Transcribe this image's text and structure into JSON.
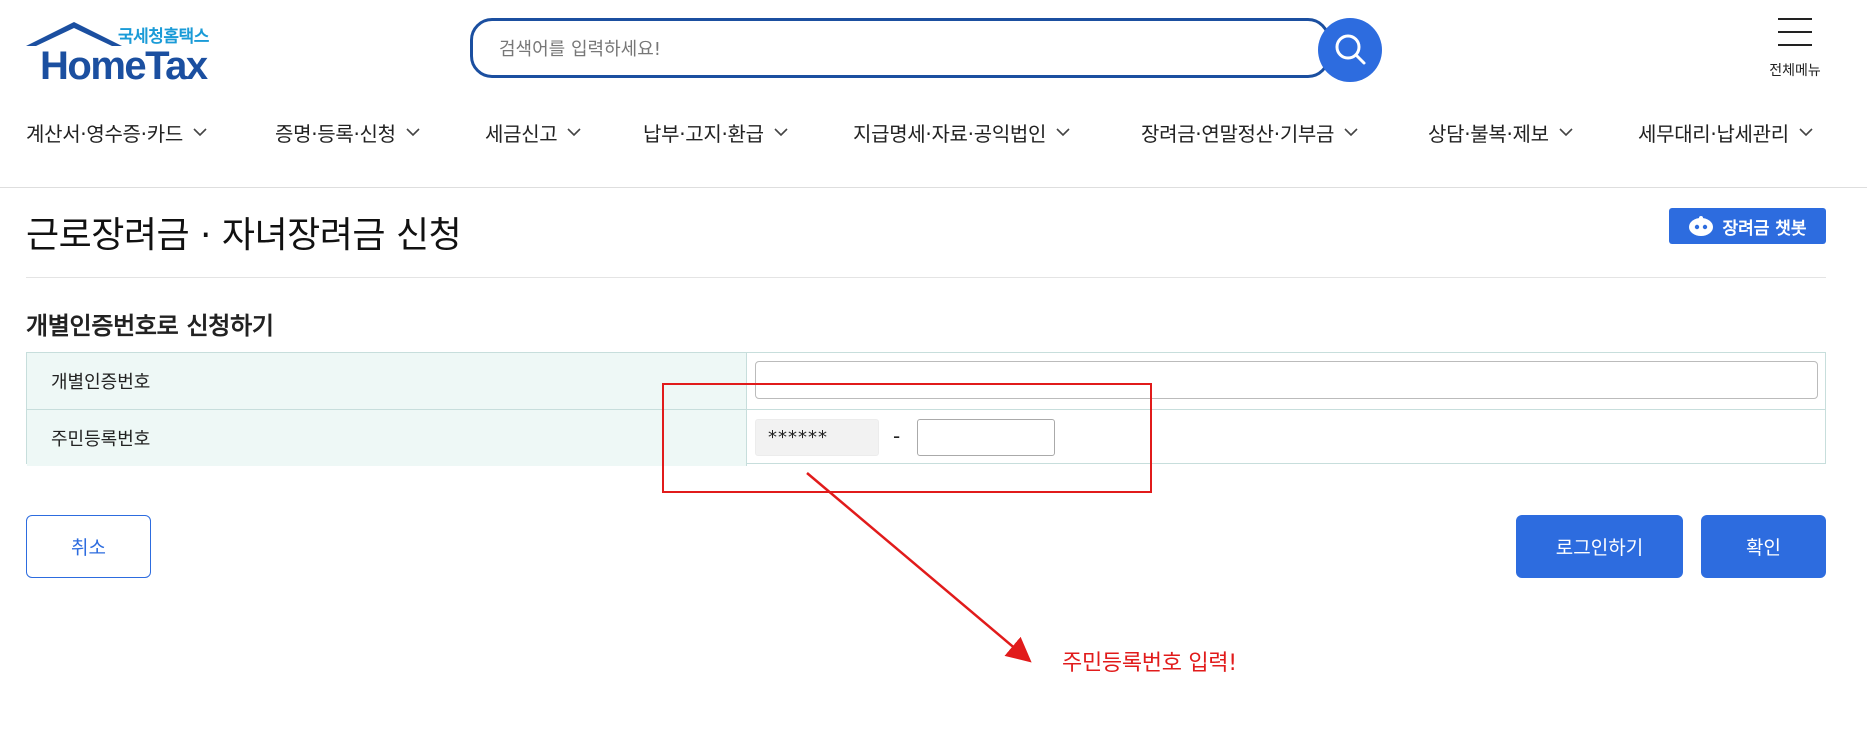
{
  "logo": {
    "sub": "국세청홈택스",
    "main": "HomeTax",
    "brand_color": "#1b4fa0"
  },
  "search": {
    "placeholder": "검색어를 입력하세요!",
    "icon": "search-icon"
  },
  "menu": {
    "label": "전체메뉴",
    "icon": "hamburger-icon"
  },
  "nav": {
    "items": [
      {
        "label": "계산서·영수증·카드"
      },
      {
        "label": "증명·등록·신청"
      },
      {
        "label": "세금신고"
      },
      {
        "label": "납부·고지·환급"
      },
      {
        "label": "지급명세·자료·공익법인"
      },
      {
        "label": "장려금·연말정산·기부금"
      },
      {
        "label": "상담·불복·제보"
      },
      {
        "label": "세무대리·납세관리"
      }
    ]
  },
  "page": {
    "title": "근로장려금 · 자녀장려금 신청",
    "chatbot_label": "장려금 챗봇",
    "section_title": "개별인증번호로 신청하기"
  },
  "form": {
    "cert_label": "개별인증번호",
    "cert_value": "",
    "rrn_label": "주민등록번호",
    "rrn_front": "******",
    "rrn_dash": "-",
    "rrn_back": ""
  },
  "buttons": {
    "cancel": "취소",
    "login": "로그인하기",
    "confirm": "확인"
  },
  "annotation": {
    "text": "주민등록번호 입력!",
    "color": "#e11b1b"
  },
  "colors": {
    "accent": "#2d6cdf",
    "table_border": "#c7dedc",
    "label_bg": "#eef8f6"
  }
}
